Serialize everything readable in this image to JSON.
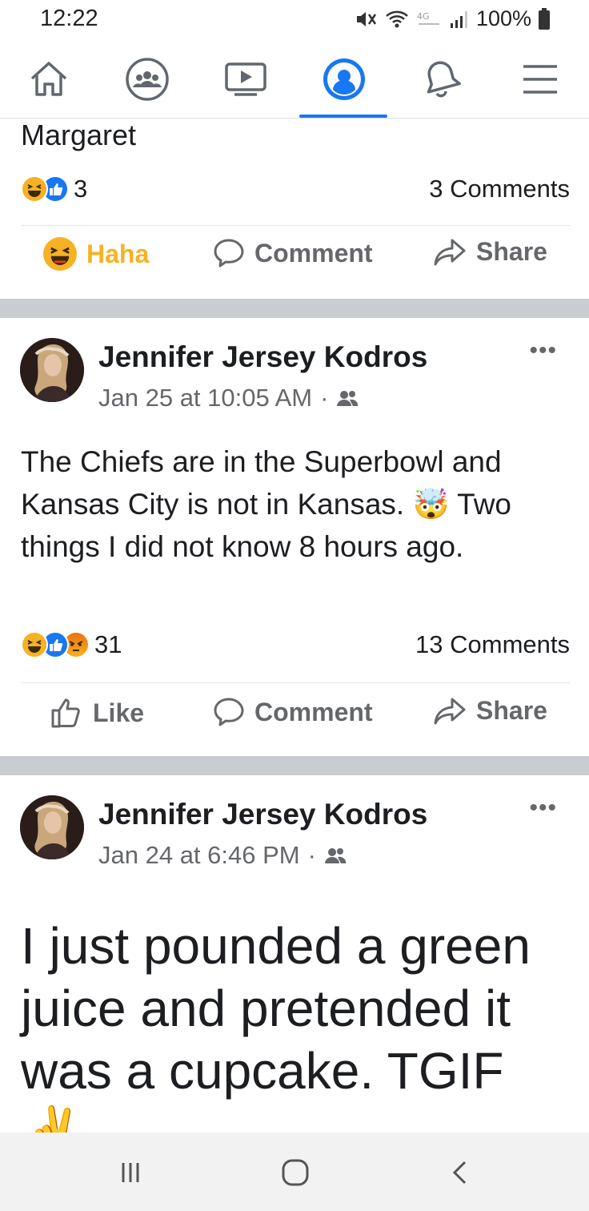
{
  "status_bar": {
    "time": "12:22",
    "battery": "100%",
    "icons": [
      "mute-icon",
      "wifi-icon",
      "signal-icon",
      "battery-icon"
    ]
  },
  "nav": {
    "items": [
      {
        "name": "home-icon",
        "active": false
      },
      {
        "name": "groups-icon",
        "active": false
      },
      {
        "name": "watch-icon",
        "active": false
      },
      {
        "name": "profile-icon",
        "active": true
      },
      {
        "name": "notifications-icon",
        "active": false
      },
      {
        "name": "menu-icon",
        "active": false
      }
    ],
    "accent": "#1877f2"
  },
  "post_fragment": {
    "text_tail": "Margaret",
    "reaction_count": "3",
    "comments": "3 Comments",
    "actions": {
      "reaction": "Haha",
      "comment": "Comment",
      "share": "Share"
    }
  },
  "posts": [
    {
      "author": "Jennifer Jersey Kodros",
      "time": "Jan 25 at 10:05 AM",
      "privacy_icon": "friends-icon",
      "text": "The Chiefs are in the Superbowl and Kansas City is not in Kansas. 🤯 Two things I did not know 8 hours ago.",
      "reaction_count": "31",
      "comments": "13 Comments",
      "actions": {
        "like": "Like",
        "comment": "Comment",
        "share": "Share"
      }
    },
    {
      "author": "Jennifer Jersey Kodros",
      "time": "Jan 24 at 6:46 PM",
      "privacy_icon": "friends-icon",
      "text": "I just pounded a green juice and pretended it was a cupcake.  TGIF ✌️"
    }
  ],
  "more_label": "•••"
}
